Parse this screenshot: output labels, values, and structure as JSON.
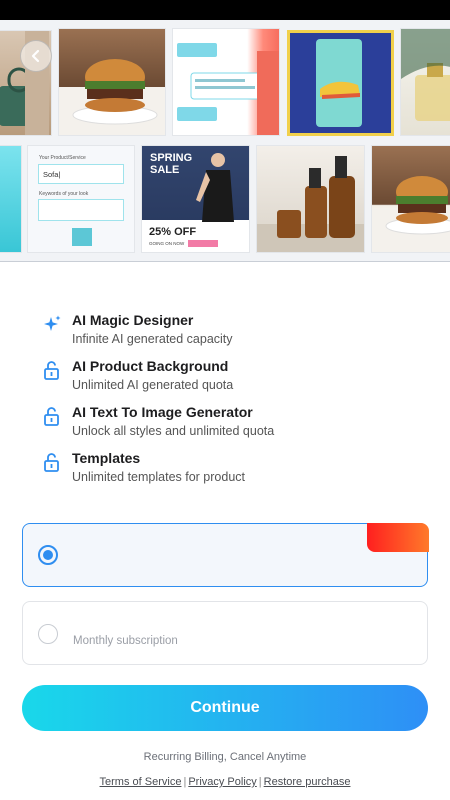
{
  "colors": {
    "accent": "#2f8ef0",
    "continue_gradient_start": "#19d8ea",
    "continue_gradient_end": "#2e8ff6",
    "badge_gradient_start": "#ff1f1f",
    "badge_gradient_end": "#ff7a2a"
  },
  "gallery": {
    "back_icon": "chevron-left-icon",
    "form_tile": {
      "label1": "Your Product/Service",
      "value1": "Sofa|",
      "label2": "Keywords of your look"
    },
    "sale_tile": {
      "line1": "SPRING",
      "line2": "SALE",
      "discount": "25% OFF",
      "tagline": "GOING ON NOW"
    }
  },
  "features": [
    {
      "icon": "sparkle-icon",
      "title": "AI Magic Designer",
      "subtitle": "Infinite AI generated capacity"
    },
    {
      "icon": "unlock-icon",
      "title": "AI Product Background",
      "subtitle": "Unlimited AI generated quota"
    },
    {
      "icon": "unlock-icon",
      "title": "AI Text To Image Generator",
      "subtitle": "Unlock all styles and unlimited quota"
    },
    {
      "icon": "unlock-icon",
      "title": "Templates",
      "subtitle": "Unlimited templates for product"
    }
  ],
  "plans": {
    "monthly_label": "Monthly subscription"
  },
  "continue_label": "Continue",
  "billing_note": "Recurring Billing, Cancel Anytime",
  "links": {
    "terms": "Terms of Service",
    "privacy": "Privacy Policy",
    "restore": "Restore purchase"
  }
}
